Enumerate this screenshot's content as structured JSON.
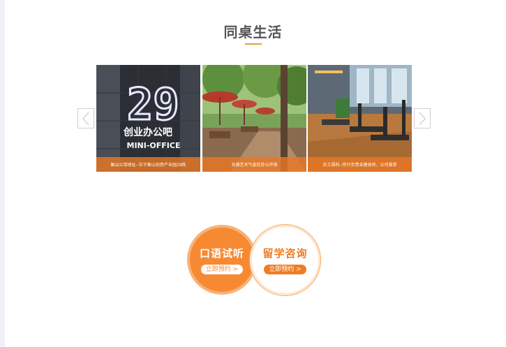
{
  "section": {
    "title": "同桌生活"
  },
  "gallery": {
    "photos": [
      {
        "caption": "衡山公馆地址--位于衡山创意产业园29栋",
        "sign_number": "29",
        "sign_text": "创业办公吧",
        "sign_subtext": "MINI-OFFICE"
      },
      {
        "caption": "充满艺术气息的办公环境"
      },
      {
        "caption": "员工福利--你只负责去健身房，公司报单"
      }
    ]
  },
  "services": {
    "trial": {
      "title": "口语试听",
      "cta": "立即预约 >"
    },
    "consult": {
      "title": "留学咨询",
      "cta": "立即预约 >"
    }
  },
  "colors": {
    "accent": "#f39a38",
    "orange_circle": "#f68a33",
    "caption_bar": "#e87824"
  }
}
